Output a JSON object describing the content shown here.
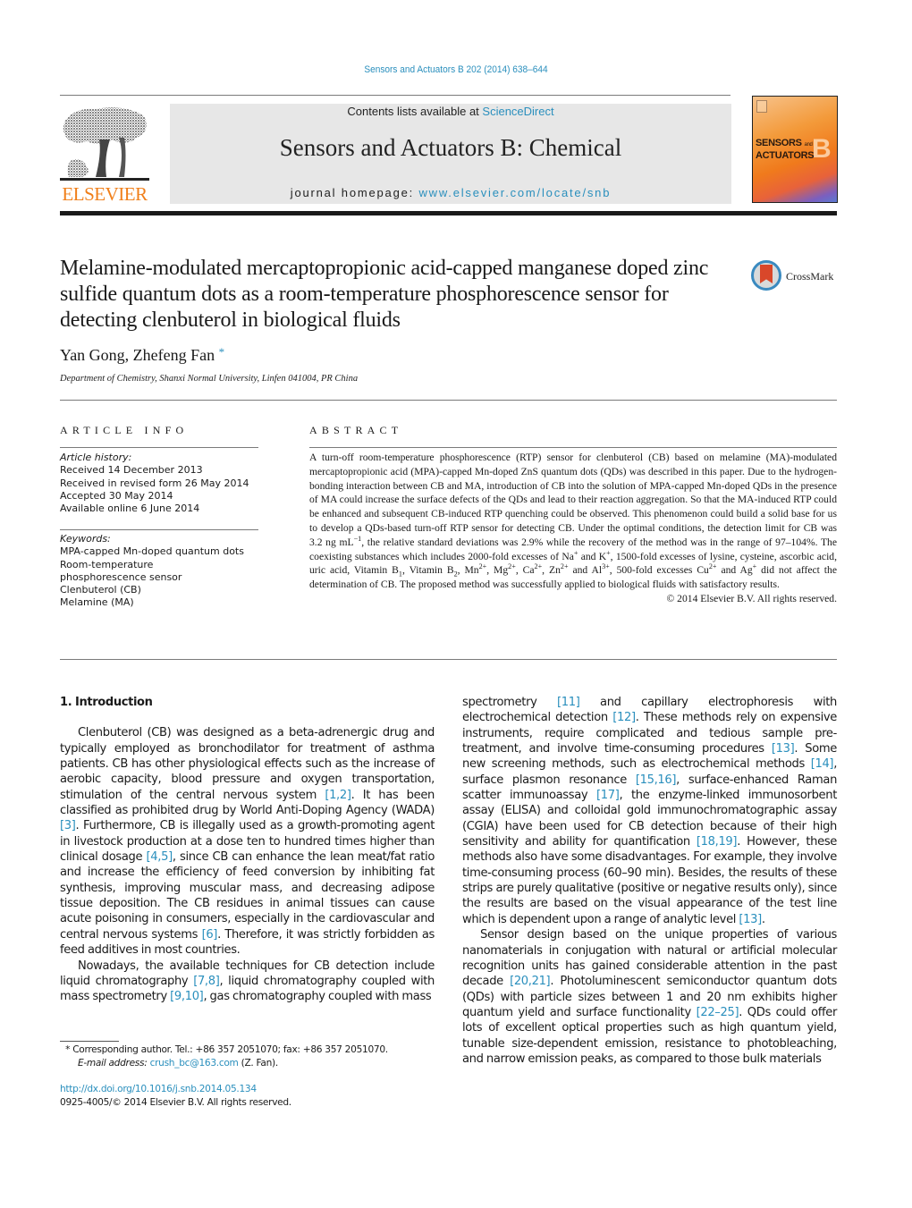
{
  "header": {
    "journal_ref": "Sensors and Actuators B 202 (2014) 638–644",
    "contents_prefix": "Contents lists available at ",
    "contents_link": "ScienceDirect",
    "journal_title": "Sensors and Actuators B: Chemical",
    "homepage_prefix": "journal homepage: ",
    "homepage_link": "www.elsevier.com/locate/snb",
    "publisher_logo_text": "ELSEVIER",
    "cover": {
      "line1": "SENSORS",
      "and": "and",
      "line2": "ACTUATORS",
      "letter": "B"
    },
    "colors": {
      "link": "#2a8fbd",
      "elsevier_orange": "#f07f1a",
      "banner_gray": "#e7e7e7"
    }
  },
  "article": {
    "title": "Melamine-modulated mercaptopropionic acid-capped manganese doped zinc sulfide quantum dots as a room-temperature phosphorescence sensor for detecting clenbuterol in biological fluids",
    "crossmark_label": "CrossMark",
    "authors": "Yan Gong, Zhefeng Fan",
    "corresponding_mark": "*",
    "affiliation": "Department of Chemistry, Shanxi Normal University, Linfen 041004, PR China"
  },
  "article_info": {
    "heading": "ARTICLE INFO",
    "history_label": "Article history:",
    "history": [
      "Received 14 December 2013",
      "Received in revised form 26 May 2014",
      "Accepted 30 May 2014",
      "Available online 6 June 2014"
    ],
    "keywords_label": "Keywords:",
    "keywords": [
      "MPA-capped Mn-doped quantum dots",
      "Room-temperature phosphorescence sensor",
      "Clenbuterol (CB)",
      "Melamine (MA)"
    ]
  },
  "abstract": {
    "heading": "ABSTRACT",
    "p1": "A turn-off room-temperature phosphorescence (RTP) sensor for clenbuterol (CB) based on melamine (MA)-modulated mercaptopropionic acid (MPA)-capped Mn-doped ZnS quantum dots (QDs) was described in this paper. Due to the hydrogen-bonding interaction between CB and MA, introduction of CB into the solution of MPA-capped Mn-doped QDs in the presence of MA could increase the surface defects of the QDs and lead to their reaction aggregation. So that the MA-induced RTP could be enhanced and subsequent CB-induced RTP quenching could be observed. This phenomenon could build a solid base for us to develop a QDs-based turn-off RTP sensor for detecting CB. Under the optimal conditions, the detection limit for CB was 3.2 ng mL",
    "p1_sup": "−1",
    "p2": ", the relative standard deviations was 2.9% while the recovery of the method was in the range of 97–104%. The coexisting substances which includes 2000-fold excesses of Na",
    "sup_plus": "+",
    "p3": " and K",
    "p4": ", 1500-fold excesses of lysine, cysteine, ascorbic acid, uric acid, Vitamin B",
    "sub1": "1",
    "p5": ", Vitamin B",
    "sub2": "2",
    "p6": ", Mn",
    "sup_2plus": "2+",
    "p7": ", Mg",
    "p8": ", Ca",
    "p9": ", Zn",
    "p10": " and Al",
    "sup_3plus": "3+",
    "p11": ", 500-fold excesses Cu",
    "p12": " and Ag",
    "p13": " did not affect the determination of CB. The proposed method was successfully applied to biological fluids with satisfactory results.",
    "copyright": "© 2014 Elsevier B.V. All rights reserved."
  },
  "body": {
    "section_heading": "1.  Introduction",
    "left": {
      "p1_a": "Clenbuterol (CB) was designed as a beta-adrenergic drug and typically employed as bronchodilator for treatment of asthma patients. CB has other physiological effects such as the increase of aerobic capacity, blood pressure and oxygen transportation, stimulation of the central nervous system ",
      "ref1": "[1,2]",
      "p1_b": ". It has been classified as prohibited drug by World Anti-Doping Agency (WADA) ",
      "ref2": "[3]",
      "p1_c": ". Furthermore, CB is illegally used as a growth-promoting agent in livestock production at a dose ten to hundred times higher than clinical dosage ",
      "ref3": "[4,5]",
      "p1_d": ", since CB can enhance the lean meat/fat ratio and increase the efficiency of feed conversion by inhibiting fat synthesis, improving muscular mass, and decreasing adipose tissue deposition. The CB residues in animal tissues can cause acute poisoning in consumers, especially in the cardiovascular and central nervous systems ",
      "ref4": "[6]",
      "p1_e": ". Therefore, it was strictly forbidden as feed additives in most countries.",
      "p2_a": "Nowadays, the available techniques for CB detection include liquid chromatography ",
      "ref5": "[7,8]",
      "p2_b": ", liquid chromatography coupled with mass spectrometry ",
      "ref6": "[9,10]",
      "p2_c": ", gas chromatography coupled with mass"
    },
    "right": {
      "p1_a": "spectrometry ",
      "ref1": "[11]",
      "p1_b": " and capillary electrophoresis with electrochemical detection ",
      "ref2": "[12]",
      "p1_c": ". These methods rely on expensive instruments, require complicated and tedious sample pre-treatment, and involve time-consuming procedures ",
      "ref3": "[13]",
      "p1_d": ". Some new screening methods, such as electrochemical methods ",
      "ref4": "[14]",
      "p1_e": ", surface plasmon resonance ",
      "ref5": "[15,16]",
      "p1_f": ", surface-enhanced Raman scatter immunoassay ",
      "ref6": "[17]",
      "p1_g": ", the enzyme-linked immunosorbent assay (ELISA) and colloidal gold immunochromatographic assay (CGIA) have been used for CB detection because of their high sensitivity and ability for quantification ",
      "ref7": "[18,19]",
      "p1_h": ". However, these methods also have some disadvantages. For example, they involve time-consuming process (60–90 min). Besides, the results of these strips are purely qualitative (positive or negative results only), since the results are based on the visual appearance of the test line which is dependent upon a range of analytic level ",
      "ref8": "[13]",
      "p1_i": ".",
      "p2_a": "Sensor design based on the unique properties of various nanomaterials in conjugation with natural or artificial molecular recognition units has gained considerable attention in the past decade ",
      "ref9": "[20,21]",
      "p2_b": ". Photoluminescent semiconductor quantum dots (QDs) with particle sizes between 1 and 20 nm exhibits higher quantum yield and surface functionality ",
      "ref10": "[22–25]",
      "p2_c": ". QDs could offer lots of excellent optical properties such as high quantum yield, tunable size-dependent emission, resistance to photobleaching, and narrow emission peaks, as compared to those bulk materials"
    }
  },
  "footnote": {
    "mark": "*",
    "text": " Corresponding author. Tel.: +86 357 2051070; fax: +86 357 2051070.",
    "email_label": "E-mail address: ",
    "email": "crush_bc@163.com",
    "email_suffix": " (Z. Fan).",
    "doi": "http://dx.doi.org/10.1016/j.snb.2014.05.134",
    "issn": "0925-4005/© 2014 Elsevier B.V. All rights reserved."
  }
}
